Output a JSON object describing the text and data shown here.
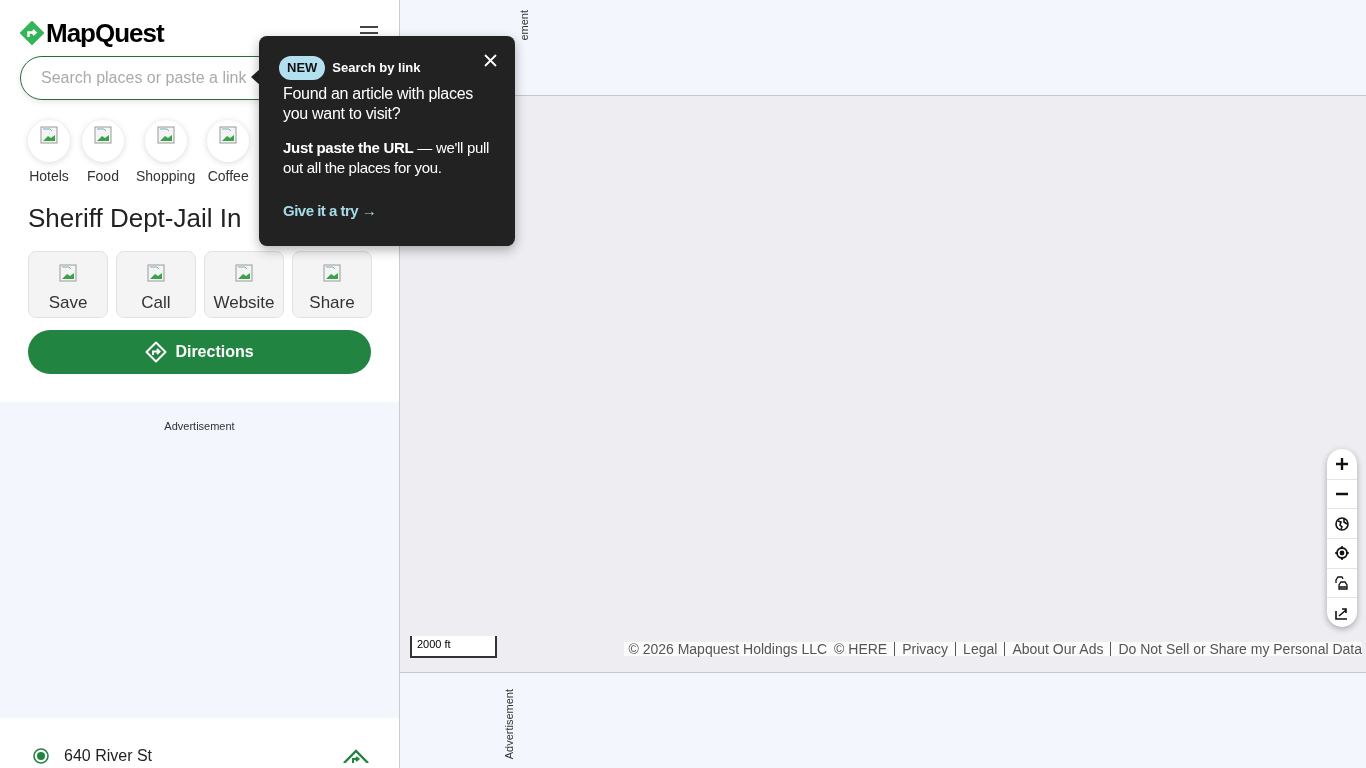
{
  "header": {
    "logo": "MapQuest"
  },
  "search": {
    "placeholder": "Search places or paste a link"
  },
  "categories": [
    {
      "label": "Hotels"
    },
    {
      "label": "Food"
    },
    {
      "label": "Shopping"
    },
    {
      "label": "Coffee"
    }
  ],
  "place": {
    "title": "Sheriff Dept-Jail In",
    "actions": [
      "Save",
      "Call",
      "Website",
      "Share"
    ],
    "directions": "Directions",
    "address": "640 River St"
  },
  "sidebar_ad": {
    "label": "Advertisement"
  },
  "popover": {
    "badge": "NEW",
    "title": "Search by link",
    "body": "Found an article with places you want to visit?",
    "tip": "**Just paste the URL** — we'll pull out all the places for you.",
    "link": "Give it a try →"
  },
  "map": {
    "top_ad_label": "ement",
    "scale": "2000 ft",
    "attribution": [
      "© 2026 Mapquest Holdings LLC",
      "© HERE",
      "Privacy",
      "Legal",
      "About Our Ads",
      "Do Not Sell or Share my Personal Data"
    ],
    "bottom_ad_label": "Advertisement"
  }
}
